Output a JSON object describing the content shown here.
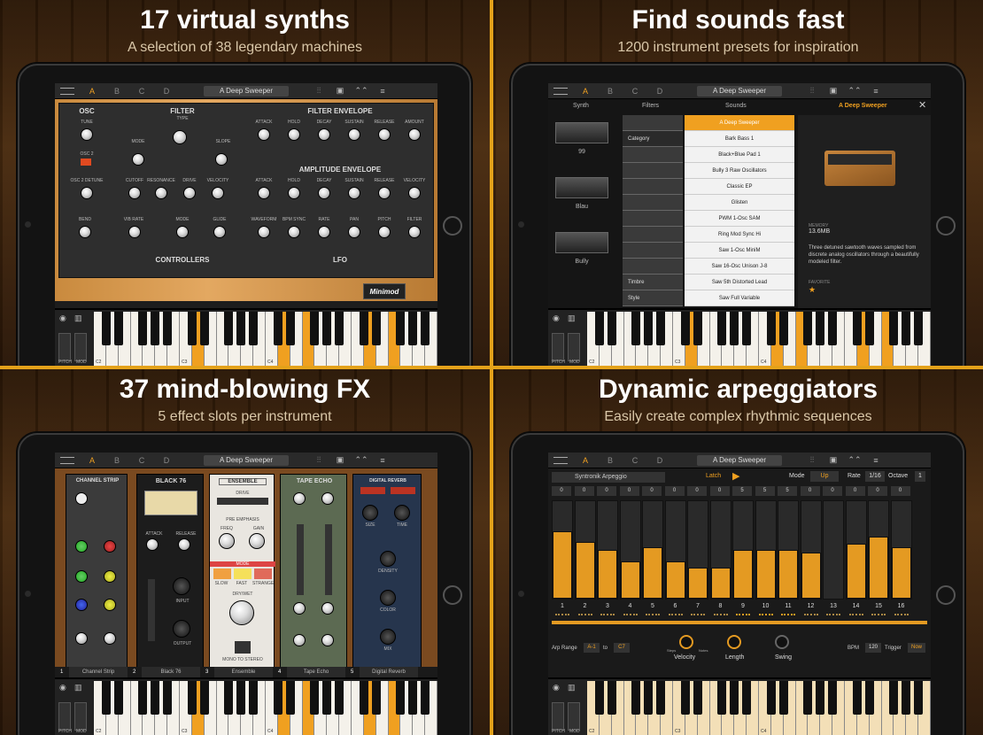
{
  "panels": [
    {
      "headline": "17 virtual synths",
      "subtitle": "A selection of 38 legendary machines"
    },
    {
      "headline": "Find sounds fast",
      "subtitle": "1200 instrument presets for inspiration"
    },
    {
      "headline": "37 mind-blowing FX",
      "subtitle": "5 effect slots per instrument"
    },
    {
      "headline": "Dynamic arpeggiators",
      "subtitle": "Easily create complex rhythmic sequences"
    }
  ],
  "topbar": {
    "slots": [
      "A",
      "B",
      "C",
      "D"
    ],
    "preset": "A Deep Sweeper"
  },
  "keyboard": {
    "pitch": "PITCH",
    "mod": "MOD",
    "notes": [
      "C2",
      "C3",
      "C4"
    ]
  },
  "synth": {
    "osc_title": "OSC",
    "tune": "TUNE",
    "osc2": "OSC 2",
    "osc2_detune": "OSC 2 DETUNE",
    "filter_title": "FILTER",
    "type": "TYPE",
    "mode": "MODE",
    "slope": "SLOPE",
    "cutoff": "CUTOFF",
    "resonance": "RESONANCE",
    "drive": "DRIVE",
    "velocity": "VELOCITY",
    "filter_env": "FILTER ENVELOPE",
    "amp_env": "AMPLITUDE ENVELOPE",
    "env_labels": [
      "ATTACK",
      "HOLD",
      "DECAY",
      "SUSTAIN",
      "RELEASE",
      "AMOUNT"
    ],
    "amp_labels": [
      "ATTACK",
      "HOLD",
      "DECAY",
      "SUSTAIN",
      "RELEASE",
      "VELOCITY"
    ],
    "bend": "BEND",
    "vib_rate": "VIB RATE",
    "glide": "GLIDE",
    "controllers": "CONTROLLERS",
    "lfo_labels": [
      "WAVEFORM",
      "BPM SYNC",
      "RATE",
      "PAN",
      "PITCH",
      "FILTER"
    ],
    "lfo": "LFO",
    "brand": "Minimod"
  },
  "browser": {
    "headers": [
      "Synth",
      "Filters",
      "Sounds",
      "A Deep Sweeper"
    ],
    "synths": [
      "99",
      "Blau",
      "Bully"
    ],
    "filters": [
      "Category",
      "Timbre",
      "Style"
    ],
    "sounds": [
      "A Deep Sweeper",
      "Bark Bass 1",
      "Black+Blue Pad 1",
      "Bully 3 Raw Oscillators",
      "Classic EP",
      "Glisten",
      "PWM 1-Osc SAM",
      "Ring Mod Sync Hi",
      "Saw 1-Osc MiniM",
      "Saw 16-Osc Unison J-8",
      "Saw 5th Distorted Lead",
      "Saw Full Variable"
    ],
    "memory_label": "MEMORY",
    "memory": "13.6MB",
    "description": "Three detuned sawtooth waves sampled from discrete analog oscillators through a beautifully modeled filter.",
    "favorite": "FAVORITE"
  },
  "fx": {
    "slots": [
      {
        "num": "1",
        "name": "Channel Strip"
      },
      {
        "num": "2",
        "name": "Black 76"
      },
      {
        "num": "3",
        "name": "Ensemble"
      },
      {
        "num": "4",
        "name": "Tape Echo"
      },
      {
        "num": "5",
        "name": "Digital Reverb"
      }
    ],
    "channel_strip": "CHANNEL STRIP",
    "black76": "BLACK 76",
    "ensemble": "ENSEMBLE",
    "tape_echo": "TAPE ECHO",
    "digital_reverb": "DIGITAL REVERB",
    "attack": "ATTACK",
    "release": "RELEASE",
    "input": "INPUT",
    "output": "OUTPUT",
    "drive": "DRIVE",
    "pre_emphasis": "PRE EMPHASIS",
    "freq": "FREQ",
    "gain": "GAIN",
    "mode": "MODE",
    "modes": [
      "SLOW",
      "FAST",
      "STRANGE"
    ],
    "drywet": "DRY/WET",
    "mono": "MONO TO STEREO",
    "size": "SIZE",
    "time": "TIME",
    "density": "DENSITY",
    "color": "COLOR",
    "mix": "MIX"
  },
  "arp": {
    "preset": "Syntronik Arpeggio",
    "latch": "Latch",
    "mode_label": "Mode",
    "mode": "Up",
    "rate_label": "Rate",
    "rate": "1/16",
    "octave_label": "Octave",
    "octave": "1",
    "step_values": [
      "0",
      "0",
      "0",
      "0",
      "0",
      "0",
      "0",
      "0",
      "5",
      "5",
      "5",
      "0",
      "0",
      "0",
      "0",
      "0"
    ],
    "velocities": [
      0.76,
      0.64,
      0.55,
      0.42,
      0.58,
      0.42,
      0.35,
      0.35,
      0.55,
      0.55,
      0.55,
      0.52,
      0.0,
      0.62,
      0.7,
      0.58
    ],
    "steps": [
      "1",
      "2",
      "3",
      "4",
      "5",
      "6",
      "7",
      "8",
      "9",
      "10",
      "11",
      "12",
      "13",
      "14",
      "15",
      "16"
    ],
    "range_label": "Arp Range",
    "range_from": "A-1",
    "to": "to",
    "range_to": "C7",
    "velocity": "Velocity",
    "length": "Length",
    "swing": "Swing",
    "steps_knob": "Steps",
    "notes_knob": "Notes",
    "bpm_label": "BPM",
    "bpm": "120",
    "trigger_label": "Trigger",
    "trigger": "Now"
  }
}
